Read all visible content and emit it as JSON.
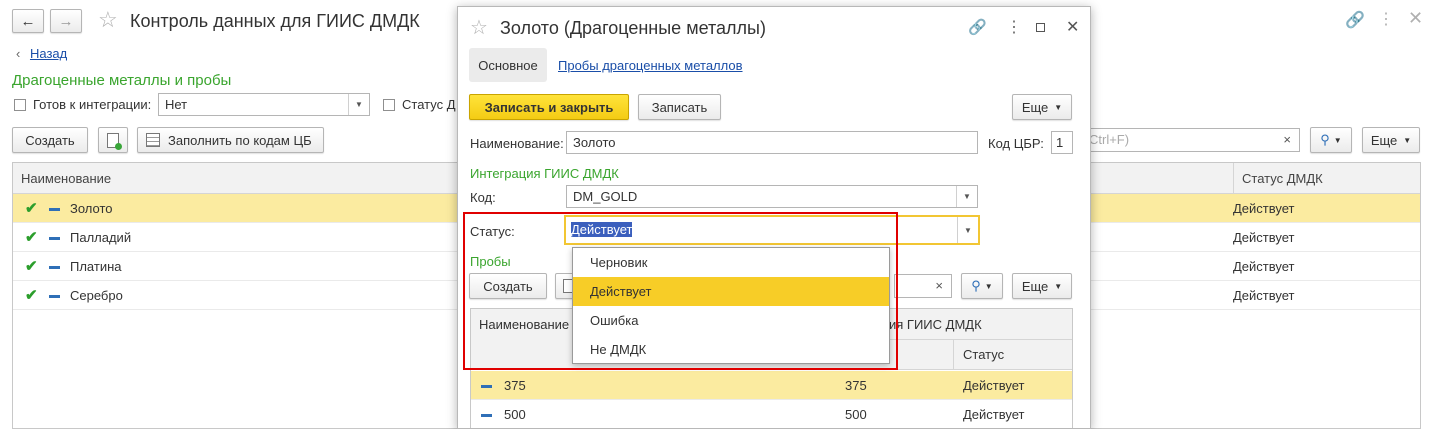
{
  "main": {
    "title": "Контроль данных для ГИИС ДМДК",
    "back_label": "Назад",
    "section_title": "Драгоценные металлы и пробы",
    "ready_label": "Готов к интеграции:",
    "ready_value": "Нет",
    "status_label": "Статус Д",
    "create_label": "Создать",
    "fill_label": "Заполнить по кодам ЦБ",
    "search_placeholder": "Ctrl+F)",
    "more_label": "Еще",
    "columns": {
      "name": "Наименование",
      "status": "Статус ДМДК"
    },
    "rows": [
      {
        "name": "Золото",
        "status": "Действует"
      },
      {
        "name": "Палладий",
        "status": "Действует"
      },
      {
        "name": "Платина",
        "status": "Действует"
      },
      {
        "name": "Серебро",
        "status": "Действует"
      }
    ]
  },
  "dialog": {
    "title": "Золото (Драгоценные металлы)",
    "tabs": {
      "main": "Основное",
      "assays": "Пробы драгоценных металлов"
    },
    "save_close_label": "Записать и закрыть",
    "save_label": "Записать",
    "more_label": "Еще",
    "name_label": "Наименование:",
    "name_value": "Золото",
    "cbr_label": "Код ЦБР:",
    "cbr_value": "1",
    "integration_title": "Интеграция ГИИС ДМДК",
    "code_label": "Код:",
    "code_value": "DM_GOLD",
    "status_label": "Статус:",
    "status_value": "Действует",
    "assays_title": "Пробы",
    "create_label": "Создать",
    "dropdown_options": [
      "Черновик",
      "Действует",
      "Ошибка",
      "Не ДМДК"
    ],
    "columns": {
      "name": "Наименование",
      "integration": "ия ГИИС ДМДК",
      "status": "Статус"
    },
    "rows": [
      {
        "name": "375",
        "code": "375",
        "status": "Действует"
      },
      {
        "name": "500",
        "code": "500",
        "status": "Действует"
      }
    ]
  },
  "colors": {
    "accent_green": "#3aa52e",
    "selection": "#fbeba0",
    "highlight_red": "#e00000",
    "button_yellow": "#f4cc14"
  }
}
